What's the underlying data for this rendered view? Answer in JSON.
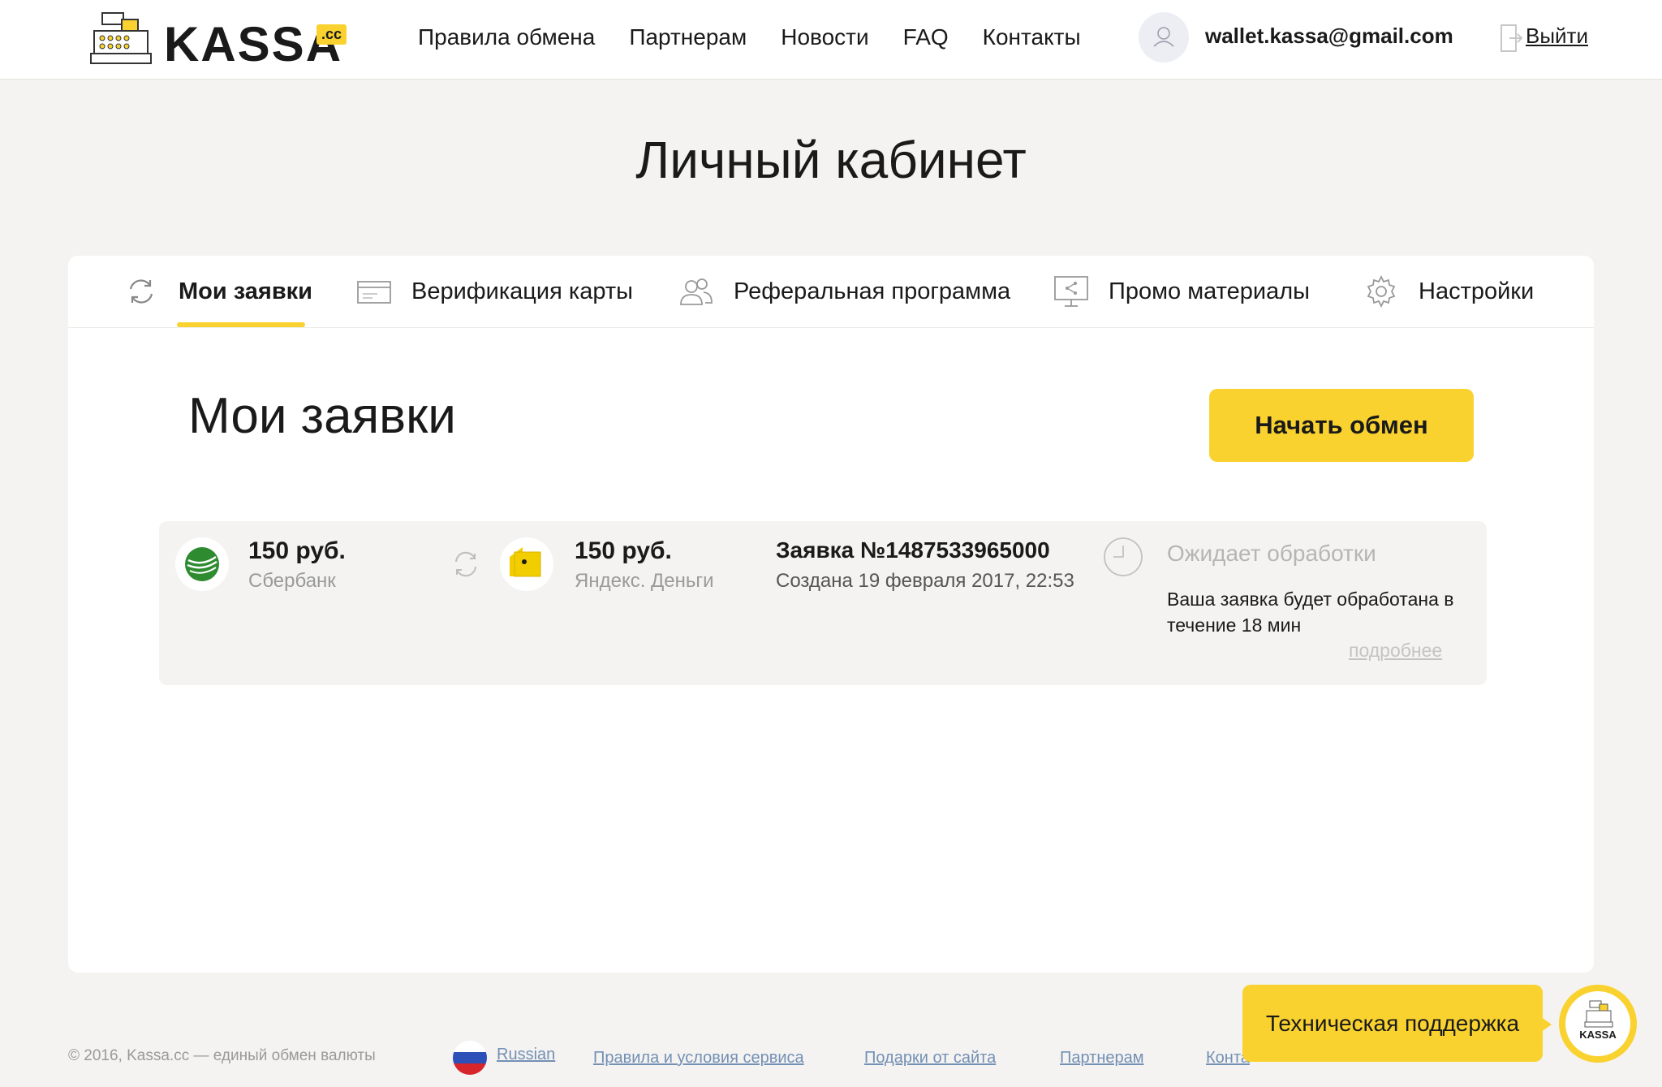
{
  "header": {
    "logo_text": "KASSA",
    "logo_suffix": ".cc",
    "nav": [
      "Правила обмена",
      "Партнерам",
      "Новости",
      "FAQ",
      "Контакты"
    ],
    "email": "wallet.kassa@gmail.com",
    "logout_label": "Выйти"
  },
  "page_title": "Личный кабинет",
  "tabs": [
    {
      "label": "Мои заявки",
      "icon": "refresh-icon",
      "active": true
    },
    {
      "label": "Верификация карты",
      "icon": "card-icon",
      "active": false
    },
    {
      "label": "Реферальная программа",
      "icon": "users-icon",
      "active": false
    },
    {
      "label": "Промо материалы",
      "icon": "monitor-share-icon",
      "active": false
    },
    {
      "label": "Настройки",
      "icon": "gear-icon",
      "active": false
    }
  ],
  "section": {
    "title": "Мои заявки",
    "start_button": "Начать обмен"
  },
  "order": {
    "from_amount": "150 руб.",
    "from_method": "Сбербанк",
    "to_amount": "150 руб.",
    "to_method": "Яндекс. Деньги",
    "number": "Заявка №1487533965000",
    "created": "Создана 19 февраля 2017, 22:53",
    "status": "Ожидает обработки",
    "status_description": "Ваша заявка будет обработана в течение 18 мин",
    "more_link": "подробнее"
  },
  "footer": {
    "copyright": "© 2016, Kassa.cc — единый обмен валюты",
    "language": "Russian",
    "links": [
      "Правила и условия сервиса",
      "Подарки от сайта",
      "Партнерам",
      "Конта"
    ]
  },
  "support": {
    "label": "Техническая поддержка",
    "avatar_text": "KASSA"
  },
  "colors": {
    "accent": "#f9d230",
    "background": "#f4f3f1",
    "link": "#7390b5"
  }
}
